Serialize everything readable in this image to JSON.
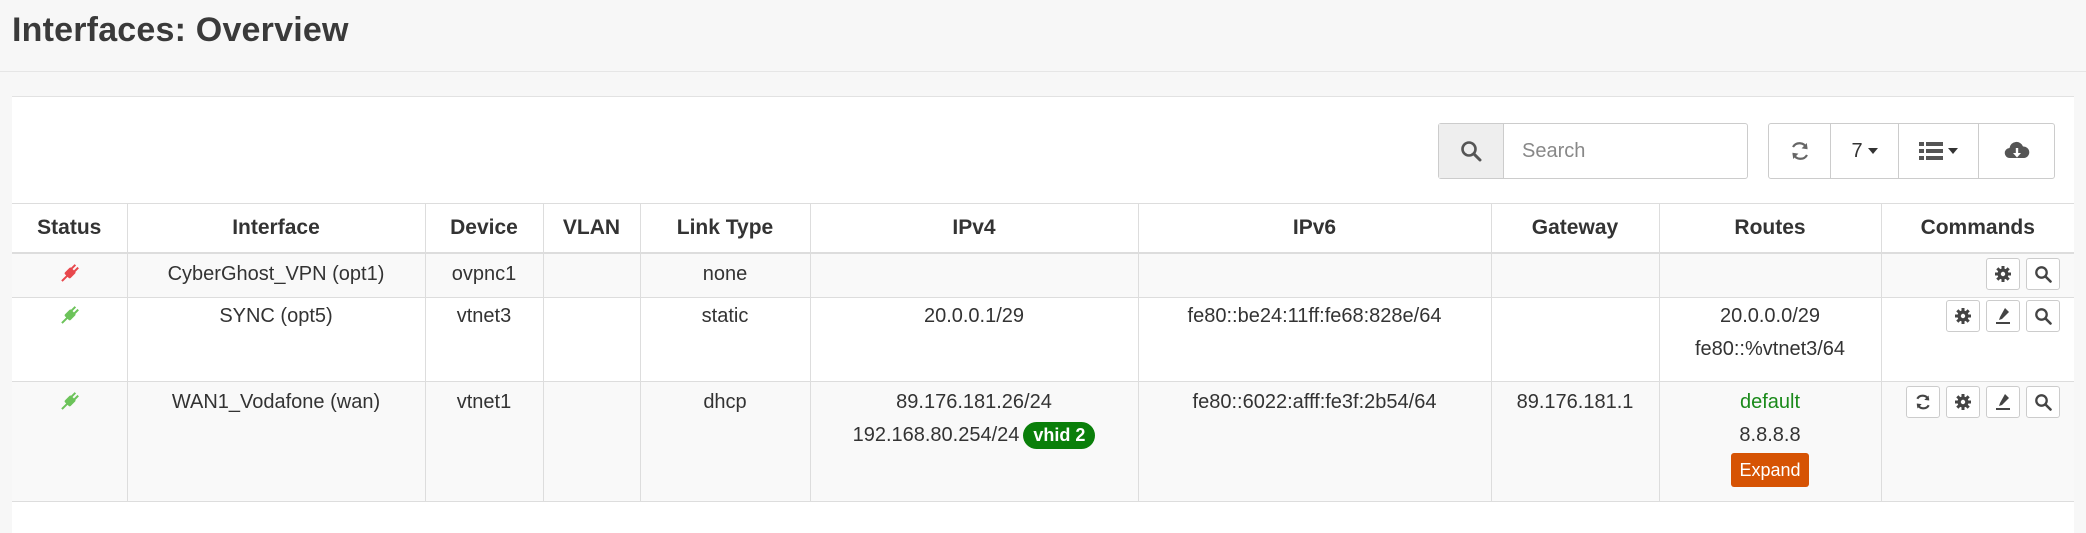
{
  "page": {
    "title": "Interfaces: Overview"
  },
  "toolbar": {
    "search_placeholder": "Search",
    "page_size": "7"
  },
  "table": {
    "columns": [
      "Status",
      "Interface",
      "Device",
      "VLAN",
      "Link Type",
      "IPv4",
      "IPv6",
      "Gateway",
      "Routes",
      "Commands"
    ],
    "rows": [
      {
        "status": "down",
        "status_color": "#e8484d",
        "interface": "CyberGhost_VPN (opt1)",
        "device": "ovpnc1",
        "vlan": "",
        "link_type": "none",
        "ipv4": "",
        "ipv6": "",
        "gateway": "",
        "routes": []
      },
      {
        "status": "up",
        "status_color": "#6cc35a",
        "interface": "SYNC (opt5)",
        "device": "vtnet3",
        "vlan": "",
        "link_type": "static",
        "ipv4": "20.0.0.1/29",
        "ipv6": "fe80::be24:11ff:fe68:828e/64",
        "gateway": "",
        "routes": [
          "20.0.0.0/29",
          "fe80::%vtnet3/64"
        ]
      },
      {
        "status": "up",
        "status_color": "#6cc35a",
        "interface": "WAN1_Vodafone (wan)",
        "device": "vtnet1",
        "vlan": "",
        "link_type": "dhcp",
        "ipv4": "89.176.181.26/24",
        "ipv4_secondary": "192.168.80.254/24",
        "ipv4_badge": "vhid 2",
        "ipv6": "fe80::6022:afff:fe3f:2b54/64",
        "gateway": "89.176.181.1",
        "routes": [
          "default",
          "8.8.8.8"
        ],
        "routes_expand": "Expand"
      }
    ]
  },
  "colors": {
    "badge_green": "#0a7f0a",
    "expand_orange": "#d65304",
    "route_default": "#1a8a1a"
  }
}
